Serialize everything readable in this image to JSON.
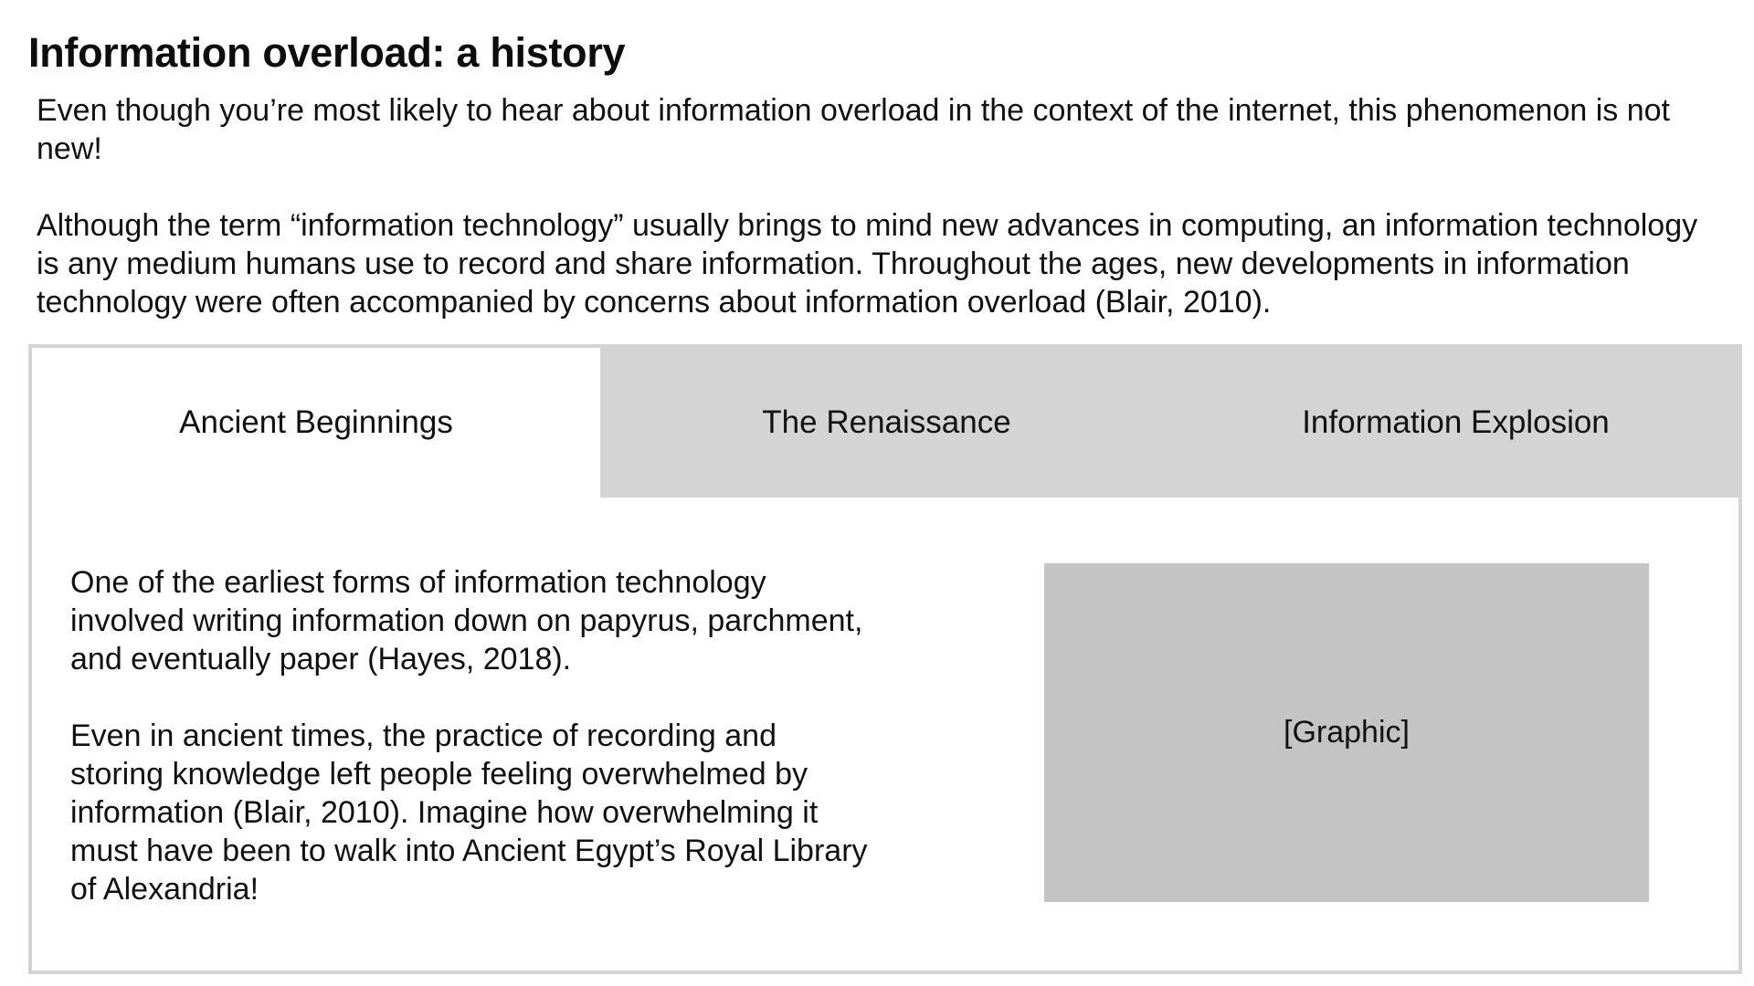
{
  "page": {
    "title": "Information overload: a history"
  },
  "intro": {
    "paragraphs": [
      "Even though you’re most likely to hear about information overload in the context of the internet, this phenomenon is not new!",
      "Although the term “information technology” usually brings to mind new advances in computing, an information technology is any medium humans use to record and share information. Throughout the ages, new developments in information technology were often accompanied by concerns about information overload (Blair, 2010)."
    ]
  },
  "tabs": {
    "items": [
      {
        "label": "Ancient Beginnings",
        "selected": true
      },
      {
        "label": "The Renaissance",
        "selected": false
      },
      {
        "label": "Information Explosion",
        "selected": false
      }
    ],
    "colors": {
      "inactive_bg": "#d4d4d4",
      "active_bg": "#ffffff",
      "border": "#d4d4d4"
    }
  },
  "panel": {
    "paragraphs": [
      "One of the earliest forms of information technology involved writing information down on papyrus, parchment, and eventually paper (Hayes, 2018).",
      "Even in ancient times, the practice of recording and storing knowledge left people feeling overwhelmed by information (Blair, 2010). Imagine how overwhelming it must have been to walk into Ancient Egypt’s Royal Library of Alexandria!"
    ],
    "graphic_label": "[Graphic]",
    "graphic_color": "#c4c4c4"
  }
}
